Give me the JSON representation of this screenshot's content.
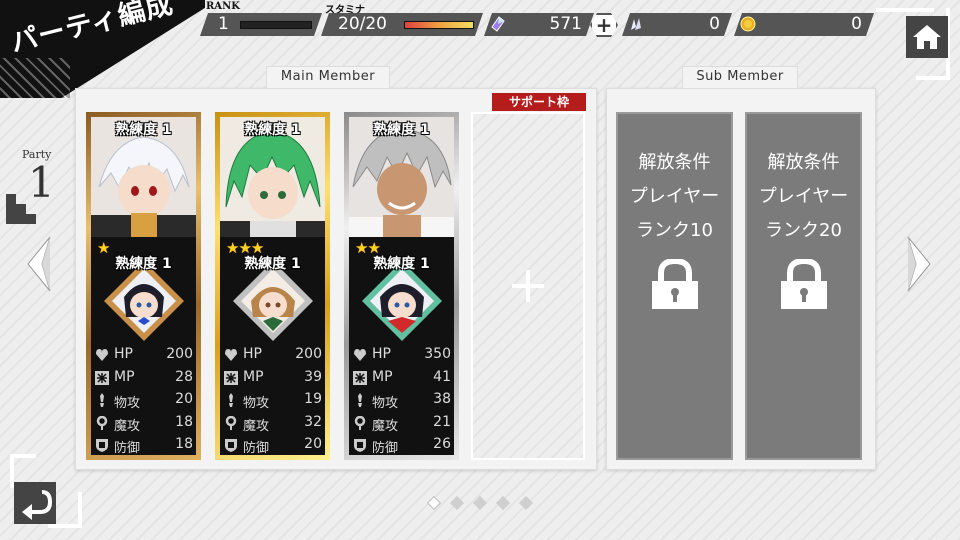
{
  "header": {
    "title": "パーティ編成",
    "rank_label": "RANK",
    "rank_value": "1",
    "rank_progress": 0.0,
    "stamina_label": "スタミナ",
    "stamina_value": "20/20",
    "stamina_progress": 1.0,
    "crystals": "571",
    "shards": "0",
    "gold": "0",
    "icons": [
      "crystal-icon",
      "shard-icon",
      "coin-icon",
      "plus-icon",
      "home-icon"
    ]
  },
  "party": {
    "label": "Party",
    "number": "1"
  },
  "panels": {
    "main_label": "Main Member",
    "sub_label": "Sub Member",
    "support_tag": "サポート枠"
  },
  "cards": [
    {
      "frame": "bronze",
      "proficiency": "熟練度 1",
      "stars": "★",
      "sub_proficiency": "熟練度 1",
      "stats": [
        {
          "label": "HP",
          "value": "200"
        },
        {
          "label": "MP",
          "value": "28"
        },
        {
          "label": "物攻",
          "value": "20"
        },
        {
          "label": "魔攻",
          "value": "18"
        },
        {
          "label": "防御",
          "value": "18"
        }
      ]
    },
    {
      "frame": "gold",
      "proficiency": "熟練度 1",
      "stars": "★★★",
      "sub_proficiency": "熟練度 1",
      "stats": [
        {
          "label": "HP",
          "value": "200"
        },
        {
          "label": "MP",
          "value": "39"
        },
        {
          "label": "物攻",
          "value": "19"
        },
        {
          "label": "魔攻",
          "value": "32"
        },
        {
          "label": "防御",
          "value": "20"
        }
      ]
    },
    {
      "frame": "silver",
      "proficiency": "熟練度 1",
      "stars": "★★",
      "sub_proficiency": "熟練度 1",
      "stats": [
        {
          "label": "HP",
          "value": "350"
        },
        {
          "label": "MP",
          "value": "41"
        },
        {
          "label": "物攻",
          "value": "38"
        },
        {
          "label": "魔攻",
          "value": "21"
        },
        {
          "label": "防御",
          "value": "26"
        }
      ]
    }
  ],
  "locked_slots": [
    {
      "line1": "解放条件",
      "line2": "プレイヤー",
      "line3": "ランク10"
    },
    {
      "line1": "解放条件",
      "line2": "プレイヤー",
      "line3": "ランク20"
    }
  ],
  "pagination": {
    "total": 5,
    "current": 1
  },
  "colors": {
    "support_tag": "#b51c1c",
    "stamina_bar": "#e04040",
    "star": "#ffd020",
    "locked_slot": "#7b7b7b"
  }
}
